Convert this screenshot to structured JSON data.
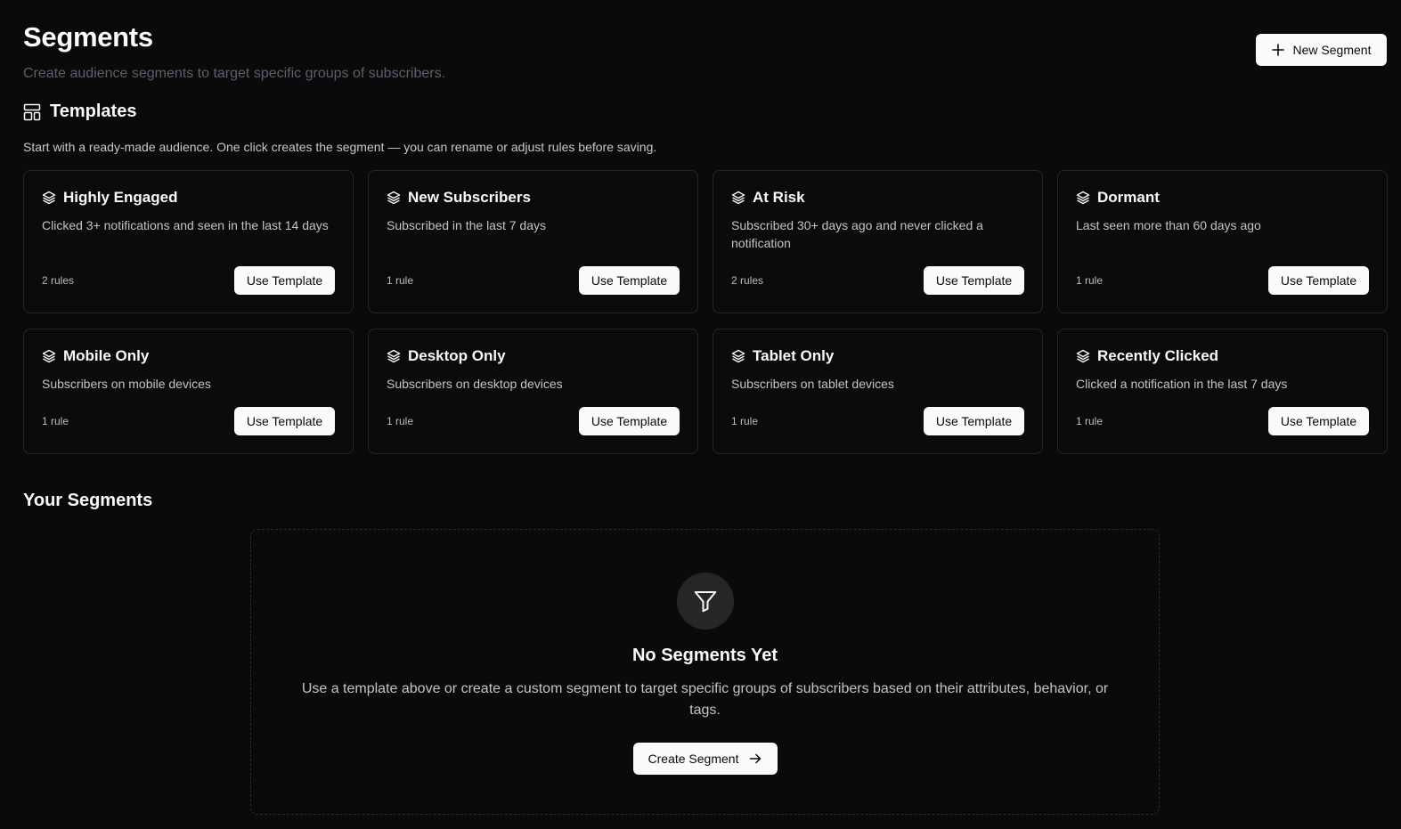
{
  "header": {
    "title": "Segments",
    "subtitle": "Create audience segments to target specific groups of subscribers.",
    "new_button_label": "New Segment",
    "new_button_icon": "plus-icon"
  },
  "templates": {
    "icon": "layout-template-icon",
    "title": "Templates",
    "description": "Start with a ready-made audience. One click creates the segment — you can rename or adjust rules before saving.",
    "items": [
      {
        "title": "Highly Engaged",
        "description": "Clicked 3+ notifications and seen in the last 14 days",
        "rules": "2 rules",
        "button": "Use Template",
        "icon": "layers-icon"
      },
      {
        "title": "New Subscribers",
        "description": "Subscribed in the last 7 days",
        "rules": "1 rule",
        "button": "Use Template",
        "icon": "layers-icon"
      },
      {
        "title": "At Risk",
        "description": "Subscribed 30+ days ago and never clicked a notification",
        "rules": "2 rules",
        "button": "Use Template",
        "icon": "layers-icon"
      },
      {
        "title": "Dormant",
        "description": "Last seen more than 60 days ago",
        "rules": "1 rule",
        "button": "Use Template",
        "icon": "layers-icon"
      },
      {
        "title": "Mobile Only",
        "description": "Subscribers on mobile devices",
        "rules": "1 rule",
        "button": "Use Template",
        "icon": "layers-icon"
      },
      {
        "title": "Desktop Only",
        "description": "Subscribers on desktop devices",
        "rules": "1 rule",
        "button": "Use Template",
        "icon": "layers-icon"
      },
      {
        "title": "Tablet Only",
        "description": "Subscribers on tablet devices",
        "rules": "1 rule",
        "button": "Use Template",
        "icon": "layers-icon"
      },
      {
        "title": "Recently Clicked",
        "description": "Clicked a notification in the last 7 days",
        "rules": "1 rule",
        "button": "Use Template",
        "icon": "layers-icon"
      }
    ]
  },
  "your_segments": {
    "title": "Your Segments",
    "empty": {
      "icon": "filter-icon",
      "title": "No Segments Yet",
      "text": "Use a template above or create a custom segment to target specific groups of subscribers based on their attributes, behavior, or tags.",
      "button_label": "Create Segment",
      "button_icon": "arrow-right-icon"
    }
  },
  "colors": {
    "background": "#0a0a0a",
    "card_border": "#262626",
    "button_bg": "#fafafa",
    "subtitle": "#5b5f6e"
  }
}
